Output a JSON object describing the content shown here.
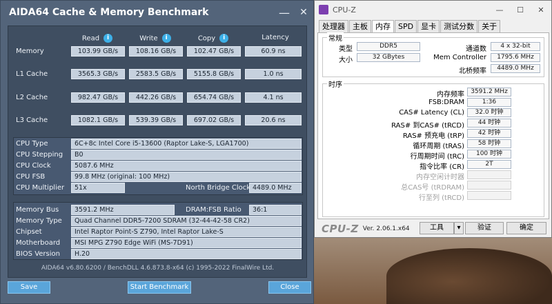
{
  "aida": {
    "title": "AIDA64 Cache & Memory Benchmark",
    "minimize": "—",
    "close": "✕",
    "columns": {
      "read": "Read",
      "write": "Write",
      "copy": "Copy",
      "latency": "Latency"
    },
    "rows": [
      {
        "label": "Memory",
        "read": "103.99 GB/s",
        "write": "108.16 GB/s",
        "copy": "102.47 GB/s",
        "latency": "60.9 ns"
      },
      {
        "label": "L1 Cache",
        "read": "3565.3 GB/s",
        "write": "2583.5 GB/s",
        "copy": "5155.8 GB/s",
        "latency": "1.0 ns"
      },
      {
        "label": "L2 Cache",
        "read": "982.47 GB/s",
        "write": "442.26 GB/s",
        "copy": "654.74 GB/s",
        "latency": "4.1 ns"
      },
      {
        "label": "L3 Cache",
        "read": "1082.1 GB/s",
        "write": "539.39 GB/s",
        "copy": "697.02 GB/s",
        "latency": "20.6 ns"
      }
    ],
    "cpu": {
      "type_label": "CPU Type",
      "type": "6C+8c Intel Core i5-13600  (Raptor Lake-S, LGA1700)",
      "stepping_label": "CPU Stepping",
      "stepping": "B0",
      "clock_label": "CPU Clock",
      "clock": "5087.6 MHz",
      "fsb_label": "CPU FSB",
      "fsb": "99.8 MHz  (original: 100 MHz)",
      "mult_label": "CPU Multiplier",
      "mult": "51x",
      "nb_label": "North Bridge Clock",
      "nb": "4489.0 MHz"
    },
    "mem": {
      "bus_label": "Memory Bus",
      "bus": "3591.2 MHz",
      "ratio_label": "DRAM:FSB Ratio",
      "ratio": "36:1",
      "type_label": "Memory Type",
      "type": "Quad Channel DDR5-7200 SDRAM  (32-44-42-58 CR2)",
      "chipset_label": "Chipset",
      "chipset": "Intel Raptor Point-S Z790, Intel Raptor Lake-S",
      "mobo_label": "Motherboard",
      "mobo": "MSI MPG Z790 Edge WiFi (MS-7D91)",
      "bios_label": "BIOS Version",
      "bios": "H.20"
    },
    "footer": "AIDA64 v6.80.6200 / BenchDLL 4.6.873.8-x64  (c) 1995-2022 FinalWire Ltd.",
    "buttons": {
      "save": "Save",
      "start": "Start Benchmark",
      "close": "Close"
    }
  },
  "cpuz": {
    "title": "CPU-Z",
    "tabs": [
      "处理器",
      "主板",
      "内存",
      "SPD",
      "显卡",
      "测试分数",
      "关于"
    ],
    "active_tab": "内存",
    "general_legend": "常规",
    "type_label": "类型",
    "type": "DDR5",
    "size_label": "大小",
    "size": "32 GBytes",
    "channels_label": "通道数",
    "channels": "4 x 32-bit",
    "memctrl_label": "Mem Controller",
    "memctrl": "1795.6 MHz",
    "nb_label": "北桥频率",
    "nb": "4489.0 MHz",
    "timings_legend": "时序",
    "timings": [
      {
        "label": "内存频率",
        "value": "3591.2 MHz"
      },
      {
        "label": "FSB:DRAM",
        "value": "1:36"
      },
      {
        "label": "CAS# Latency (CL)",
        "value": "32.0 时钟"
      },
      {
        "label": "RAS# 到CAS# (tRCD)",
        "value": "44 时钟"
      },
      {
        "label": "RAS# 预充电 (tRP)",
        "value": "42 时钟"
      },
      {
        "label": "循环周期 (tRAS)",
        "value": "58 时钟"
      },
      {
        "label": "行周期时间 (tRC)",
        "value": "100 时钟"
      },
      {
        "label": "指令比率 (CR)",
        "value": "2T"
      },
      {
        "label": "内存空闲计时器",
        "value": ""
      },
      {
        "label": "总CAS号 (tRDRAM)",
        "value": ""
      },
      {
        "label": "行至列 (tRCD)",
        "value": ""
      }
    ],
    "brand": "CPU-Z",
    "version": "Ver. 2.06.1.x64",
    "tools_btn": "工具",
    "validate_btn": "验证",
    "ok_btn": "确定"
  }
}
